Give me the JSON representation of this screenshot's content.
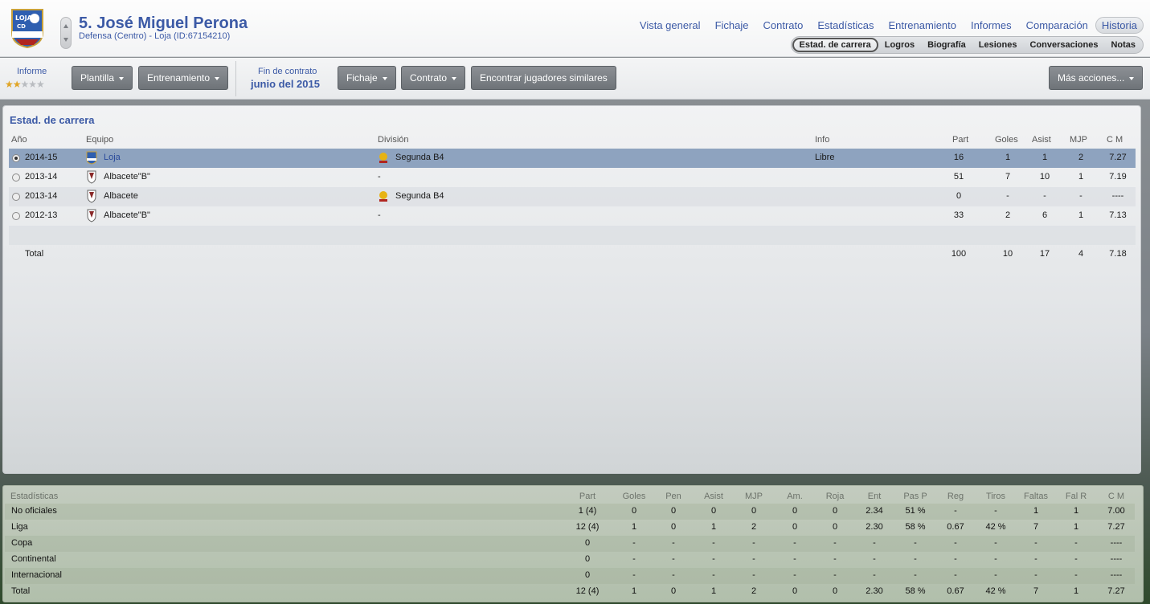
{
  "header": {
    "crest_text": "LOJA CD",
    "name": "5. José Miguel Perona",
    "subtitle": "Defensa (Centro) - Loja (ID:67154210)",
    "nav": [
      "Vista general",
      "Fichaje",
      "Contrato",
      "Estadísticas",
      "Entrenamiento",
      "Informes",
      "Comparación",
      "Historia"
    ],
    "nav_active": "Historia",
    "subnav": [
      "Estad. de carrera",
      "Logros",
      "Biografía",
      "Lesiones",
      "Conversaciones",
      "Notas"
    ],
    "subnav_active": "Estad. de carrera"
  },
  "toolbar": {
    "informe_label": "Informe",
    "stars": 2,
    "max_stars": 5,
    "plantilla": "Plantilla",
    "entrenamiento": "Entrenamiento",
    "contract_label": "Fin de contrato",
    "contract_value": "junio del 2015",
    "fichaje": "Fichaje",
    "contrato": "Contrato",
    "similares": "Encontrar jugadores similares",
    "mas": "Más acciones..."
  },
  "career": {
    "title": "Estad. de carrera",
    "headers": {
      "year": "Año",
      "team": "Equipo",
      "division": "División",
      "info": "Info",
      "part": "Part",
      "goles": "Goles",
      "asist": "Asist",
      "mjp": "MJP",
      "cm": "C M"
    },
    "rows": [
      {
        "year": "2014-15",
        "team": "Loja",
        "division": "Segunda B4",
        "info": "Libre",
        "part": "16",
        "goles": "1",
        "asist": "1",
        "mjp": "2",
        "cm": "7.27"
      },
      {
        "year": "2013-14",
        "team": "Albacete\"B\"",
        "division": "-",
        "info": "",
        "part": "51",
        "goles": "7",
        "asist": "10",
        "mjp": "1",
        "cm": "7.19"
      },
      {
        "year": "2013-14",
        "team": "Albacete",
        "division": "Segunda B4",
        "info": "",
        "part": "0",
        "goles": "-",
        "asist": "-",
        "mjp": "-",
        "cm": "----"
      },
      {
        "year": "2012-13",
        "team": "Albacete\"B\"",
        "division": "-",
        "info": "",
        "part": "33",
        "goles": "2",
        "asist": "6",
        "mjp": "1",
        "cm": "7.13"
      }
    ],
    "total": {
      "label": "Total",
      "part": "100",
      "goles": "10",
      "asist": "17",
      "mjp": "4",
      "cm": "7.18"
    }
  },
  "stats": {
    "headers": [
      "Estadísticas",
      "Part",
      "Goles",
      "Pen",
      "Asist",
      "MJP",
      "Am.",
      "Roja",
      "Ent",
      "Pas P",
      "Reg",
      "Tiros",
      "Faltas",
      "Fal R",
      "C M"
    ],
    "rows": [
      {
        "label": "No oficiales",
        "values": [
          "1 (4)",
          "0",
          "0",
          "0",
          "0",
          "0",
          "0",
          "2.34",
          "51 %",
          "-",
          "-",
          "1",
          "1",
          "7.00"
        ]
      },
      {
        "label": "Liga",
        "values": [
          "12 (4)",
          "1",
          "0",
          "1",
          "2",
          "0",
          "0",
          "2.30",
          "58 %",
          "0.67",
          "42 %",
          "7",
          "1",
          "7.27"
        ]
      },
      {
        "label": "Copa",
        "values": [
          "0",
          "-",
          "-",
          "-",
          "-",
          "-",
          "-",
          "-",
          "-",
          "-",
          "-",
          "-",
          "-",
          "----"
        ]
      },
      {
        "label": "Continental",
        "values": [
          "0",
          "-",
          "-",
          "-",
          "-",
          "-",
          "-",
          "-",
          "-",
          "-",
          "-",
          "-",
          "-",
          "----"
        ]
      },
      {
        "label": "Internacional",
        "values": [
          "0",
          "-",
          "-",
          "-",
          "-",
          "-",
          "-",
          "-",
          "-",
          "-",
          "-",
          "-",
          "-",
          "----"
        ]
      },
      {
        "label": "Total",
        "values": [
          "12 (4)",
          "1",
          "0",
          "1",
          "2",
          "0",
          "0",
          "2.30",
          "58 %",
          "0.67",
          "42 %",
          "7",
          "1",
          "7.27"
        ]
      }
    ]
  },
  "colors": {
    "accent": "#3c5aa6",
    "selected_row": "#8ea3bf",
    "star": "#e0a526"
  },
  "icons": {
    "crest": "club-crest-icon",
    "scroll": "up-down-arrows-icon",
    "division": "rfef-badge-icon"
  }
}
